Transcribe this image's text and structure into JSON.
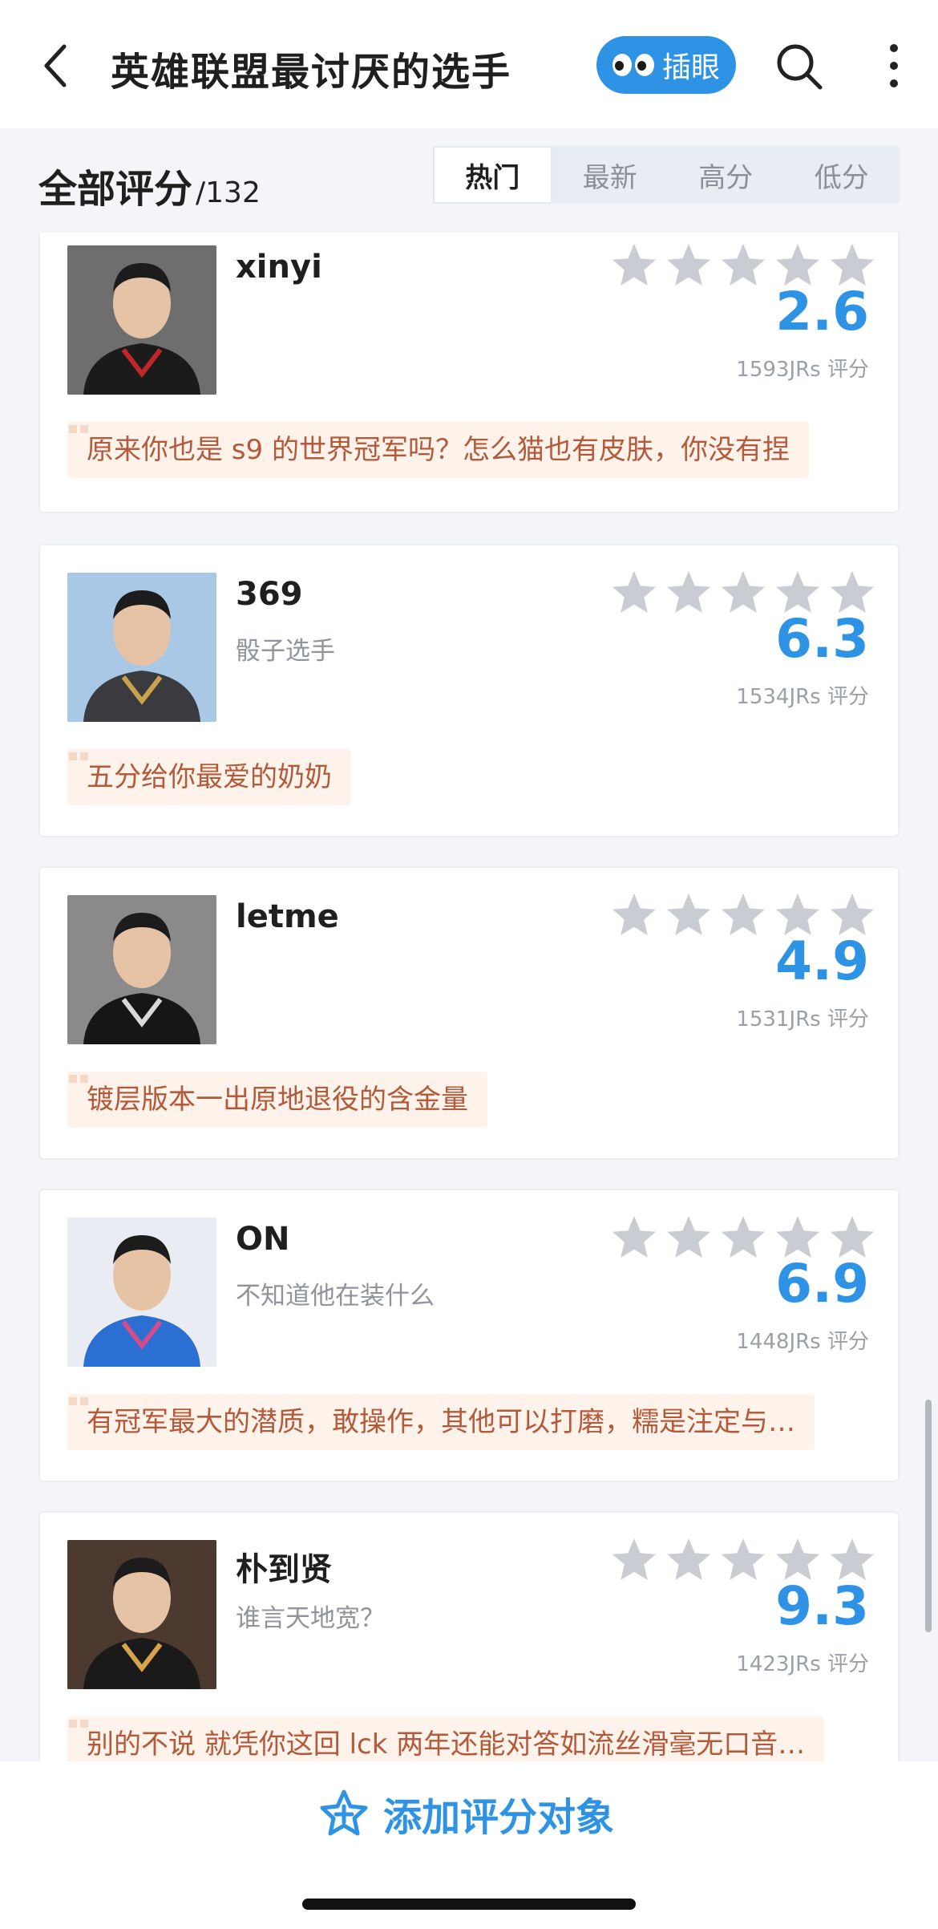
{
  "header": {
    "title": "英雄联盟最讨厌的选手",
    "chayan_label": "插眼"
  },
  "filter": {
    "all_label": "全部评分",
    "count": "/132",
    "tabs": [
      "热门",
      "最新",
      "高分",
      "低分"
    ],
    "active_tab": "热门"
  },
  "items": [
    {
      "name": "xinyi",
      "subtitle": "",
      "score": "2.6",
      "raters": "1593JRs 评分",
      "comment": "原来你也是 s9 的世界冠军吗？怎么猫也有皮肤，你没有捏",
      "avatar_colors": {
        "bg": "#6e6e6e",
        "shirt": "#1b1b1b",
        "accent": "#c0262b"
      }
    },
    {
      "name": "369",
      "subtitle": "骰子选手",
      "score": "6.3",
      "raters": "1534JRs 评分",
      "comment": "五分给你最爱的奶奶",
      "avatar_colors": {
        "bg": "#a9c8e6",
        "shirt": "#3b3b3f",
        "accent": "#c9a24b"
      }
    },
    {
      "name": "letme",
      "subtitle": "",
      "score": "4.9",
      "raters": "1531JRs 评分",
      "comment": "镀层版本一出原地退役的含金量",
      "avatar_colors": {
        "bg": "#8a8a8a",
        "shirt": "#161616",
        "accent": "#d8d8d8"
      }
    },
    {
      "name": "ON",
      "subtitle": "不知道他在装什么",
      "score": "6.9",
      "raters": "1448JRs 评分",
      "comment": "有冠军最大的潜质，敢操作，其他可以打磨，糯是注定与…",
      "avatar_colors": {
        "bg": "#e9edf3",
        "shirt": "#2a6fd1",
        "accent": "#d24d8a"
      }
    },
    {
      "name": "朴到贤",
      "subtitle": "谁言天地宽？",
      "score": "9.3",
      "raters": "1423JRs 评分",
      "comment": "别的不说 就凭你这回 lck 两年还能对答如流丝滑毫无口音…",
      "avatar_colors": {
        "bg": "#4c3a30",
        "shirt": "#1a1a1a",
        "accent": "#d8a34a"
      }
    }
  ],
  "footer": {
    "add_label": "添加评分对象"
  },
  "colors": {
    "accent": "#2f93e5",
    "star_empty": "#c9ccd2",
    "comment_bg": "#fdf3ea",
    "comment_text": "#b4593a"
  }
}
